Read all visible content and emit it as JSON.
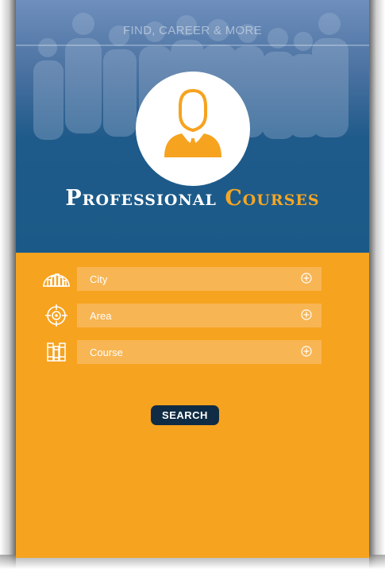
{
  "header": {
    "title": "FIND, CAREER & MORE"
  },
  "hero": {
    "title_part1": "Professional",
    "title_part2": "Courses"
  },
  "form": {
    "fields": [
      {
        "label": "City",
        "icon": "city-skyline-icon"
      },
      {
        "label": "Area",
        "icon": "target-crosshair-icon"
      },
      {
        "label": "Course",
        "icon": "books-icon"
      }
    ],
    "search_label": "SEARCH"
  },
  "colors": {
    "hero_blue": "#1b5a88",
    "accent_orange": "#f6a320",
    "field_orange": "#f8b553",
    "button_navy": "#102c44"
  }
}
